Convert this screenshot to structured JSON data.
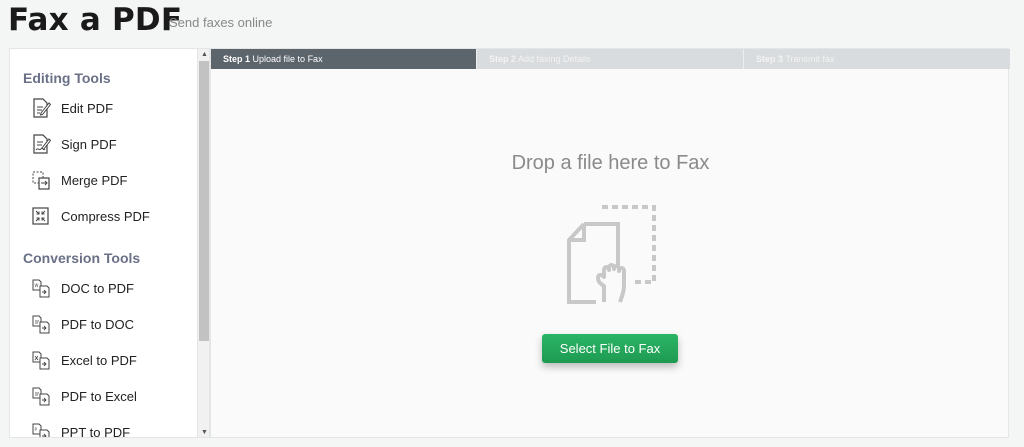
{
  "header": {
    "title": "Fax a PDF",
    "subtitle": "Send faxes online"
  },
  "sidebar": {
    "sections": [
      {
        "title": "Editing Tools",
        "items": [
          {
            "label": "Edit PDF",
            "icon": "edit-pdf-icon"
          },
          {
            "label": "Sign PDF",
            "icon": "sign-pdf-icon"
          },
          {
            "label": "Merge PDF",
            "icon": "merge-pdf-icon"
          },
          {
            "label": "Compress PDF",
            "icon": "compress-pdf-icon"
          }
        ]
      },
      {
        "title": "Conversion Tools",
        "items": [
          {
            "label": "DOC to PDF",
            "icon": "convert-icon"
          },
          {
            "label": "PDF to DOC",
            "icon": "convert-icon"
          },
          {
            "label": "Excel to PDF",
            "icon": "convert-icon"
          },
          {
            "label": "PDF to Excel",
            "icon": "convert-icon"
          },
          {
            "label": "PPT to PDF",
            "icon": "convert-icon"
          }
        ]
      }
    ]
  },
  "steps": [
    {
      "num": "Step 1",
      "label": "Upload file to Fax",
      "active": true
    },
    {
      "num": "Step 2",
      "label": "Add faxing Details",
      "active": false
    },
    {
      "num": "Step 3",
      "label": "Transmit fax",
      "active": false
    }
  ],
  "upload": {
    "drop_text": "Drop a file here to Fax",
    "button_label": "Select File to Fax",
    "icon": "drag-file-icon"
  },
  "colors": {
    "accent_green": "#22a85a",
    "active_step": "#5c646c",
    "section_title": "#6a7187"
  }
}
